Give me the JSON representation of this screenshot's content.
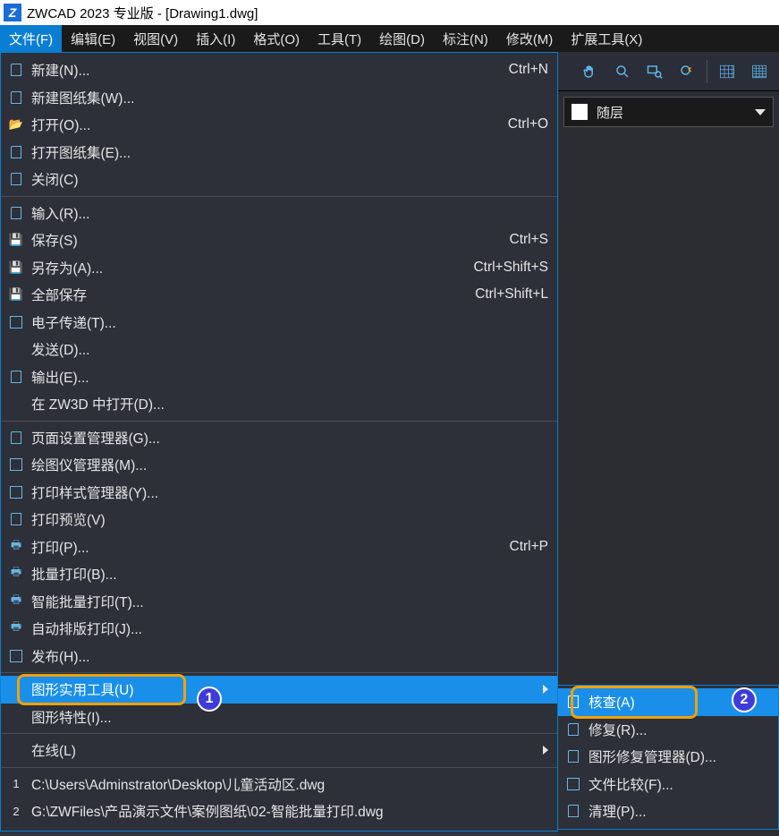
{
  "title": "ZWCAD 2023 专业版 - [Drawing1.dwg]",
  "menubar": {
    "file": "文件(F)",
    "edit": "编辑(E)",
    "view": "视图(V)",
    "insert": "插入(I)",
    "format": "格式(O)",
    "tools": "工具(T)",
    "draw": "绘图(D)",
    "dim": "标注(N)",
    "modify": "修改(M)",
    "ext": "扩展工具(X)"
  },
  "fileMenu": {
    "sec1": {
      "new": "新建(N)...",
      "newsheet": "新建图纸集(W)...",
      "open": "打开(O)...",
      "opensheet": "打开图纸集(E)...",
      "close": "关闭(C)",
      "new_sc": "Ctrl+N",
      "open_sc": "Ctrl+O"
    },
    "sec2": {
      "import": "输入(R)...",
      "save": "保存(S)",
      "save_sc": "Ctrl+S",
      "saveas": "另存为(A)...",
      "saveas_sc": "Ctrl+Shift+S",
      "saveall": "全部保存",
      "saveall_sc": "Ctrl+Shift+L",
      "etrans": "电子传递(T)...",
      "send": "发送(D)...",
      "export": "输出(E)...",
      "openzw3d": "在 ZW3D 中打开(D)..."
    },
    "sec3": {
      "pagesetup": "页面设置管理器(G)...",
      "plotter": "绘图仪管理器(M)...",
      "plotstyle": "打印样式管理器(Y)...",
      "preview": "打印预览(V)",
      "print": "打印(P)...",
      "print_sc": "Ctrl+P",
      "batchprint": "批量打印(B)...",
      "smartbatch": "智能批量打印(T)...",
      "autoarr": "自动排版打印(J)...",
      "publish": "发布(H)..."
    },
    "sec4": {
      "utilities": "图形实用工具(U)",
      "props": "图形特性(I)..."
    },
    "sec5": {
      "online": "在线(L)"
    },
    "sec6": {
      "recent1": "C:\\Users\\Adminstrator\\Desktop\\儿童活动区.dwg",
      "recent1_num": "1",
      "recent2": "G:\\ZWFiles\\产品演示文件\\案例图纸\\02-智能批量打印.dwg",
      "recent2_num": "2"
    }
  },
  "submenu": {
    "audit": "核查(A)",
    "recover": "修复(R)...",
    "recmgr": "图形修复管理器(D)...",
    "compare": "文件比较(F)...",
    "purge": "清理(P)..."
  },
  "rightPanel": {
    "layer": "随层"
  },
  "annotations": {
    "badge1": "1",
    "badge2": "2"
  }
}
